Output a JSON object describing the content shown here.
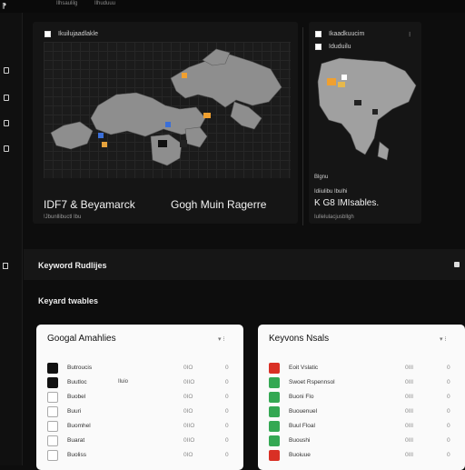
{
  "topbar": {
    "logo_glyph": "⁋",
    "item1": "Ilhsaulilg",
    "item2": "Ilhuduuu"
  },
  "sidebar": {
    "icons": [
      "page-icon",
      "page-icon",
      "page-icon",
      "page-icon"
    ]
  },
  "left_card": {
    "header": "Ikuilujaadlakle",
    "title": "IDF7 & Beyamarck",
    "subtitle": "!Jbunllibuctl Ibu"
  },
  "middle_card": {
    "title": "Gogh Muin Ragerre"
  },
  "right_card": {
    "header1": "Ikaadkuucim",
    "header2": "Iduduilu",
    "menu_glyph": "⁝",
    "label": "Blgnu",
    "label2": "Idiiulibu Ibulhi",
    "title": "K G8 IMIsables.",
    "subtitle": "Iullelulacjusbllgh"
  },
  "band": {
    "label": "Keyword Rudlijes"
  },
  "section_title": "Keyard twables",
  "panels": [
    {
      "title": "Googal Amahlies",
      "controls": "▾  ⁝",
      "rows": [
        {
          "name": "Butroucis",
          "v1": "0IO",
          "v2": "0",
          "color": "#111111",
          "tag": ""
        },
        {
          "name": "Buutloc",
          "v1": "0IIO",
          "v2": "0",
          "color": "#111111",
          "tag": "Iluio"
        },
        {
          "name": "Buobel",
          "v1": "0IO",
          "v2": "0",
          "color": "#ffffff",
          "tag": ""
        },
        {
          "name": "Buuri",
          "v1": "0IO",
          "v2": "0",
          "color": "#ffffff",
          "tag": ""
        },
        {
          "name": "Buomhel",
          "v1": "0IIO",
          "v2": "0",
          "color": "#ffffff",
          "tag": ""
        },
        {
          "name": "Buarat",
          "v1": "0IIO",
          "v2": "0",
          "color": "#ffffff",
          "tag": ""
        },
        {
          "name": "Buoliss",
          "v1": "0IO",
          "v2": "0",
          "color": "#ffffff",
          "tag": ""
        }
      ]
    },
    {
      "title": "Keyvons Nsals",
      "controls": "▾  ⁝",
      "rows": [
        {
          "name": "Eoit Vslatic",
          "v1": "0III",
          "v2": "0",
          "color": "#d93025",
          "tag": ""
        },
        {
          "name": "Swoet Rspennsol",
          "v1": "0III",
          "v2": "0",
          "color": "#34a853",
          "tag": ""
        },
        {
          "name": "Buoni Flo",
          "v1": "0III",
          "v2": "0",
          "color": "#34a853",
          "tag": ""
        },
        {
          "name": "Buouenuel",
          "v1": "0III",
          "v2": "0",
          "color": "#34a853",
          "tag": ""
        },
        {
          "name": "Buul Floal",
          "v1": "0III",
          "v2": "0",
          "color": "#34a853",
          "tag": ""
        },
        {
          "name": "Buoushi",
          "v1": "0III",
          "v2": "0",
          "color": "#34a853",
          "tag": ""
        },
        {
          "name": "Buoiuue",
          "v1": "0III",
          "v2": "0",
          "color": "#d93025",
          "tag": ""
        }
      ]
    }
  ]
}
